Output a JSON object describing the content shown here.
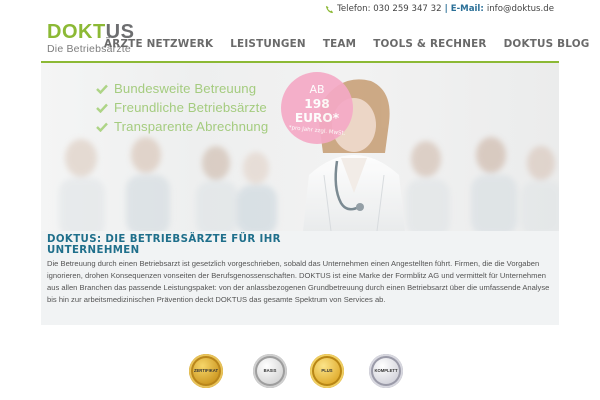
{
  "topbar": {
    "phone": "Telefon: 030 259 347 32",
    "separator": "|",
    "email_label": "E-Mail:",
    "email": "info@doktus.de"
  },
  "logo": {
    "brand_a": "DOKT",
    "brand_b": "US",
    "tagline": "Die Betriebsärzte"
  },
  "nav": {
    "items": [
      "ÄRZTE NETZWERK",
      "LEISTUNGEN",
      "TEAM",
      "TOOLS & RECHNER",
      "DOKTUS BLOG"
    ]
  },
  "hero": {
    "benefits": [
      "Bundesweite Betreuung",
      "Freundliche Betriebsärzte",
      "Transparente Abrechnung"
    ],
    "badge": {
      "ab": "AB",
      "price": "198 EURO*",
      "note": "*pro Jahr zzgl. MwSt."
    }
  },
  "intro": {
    "heading": "DOKTUS: DIE BETRIEBSÄRZTE FÜR IHR UNTERNEHMEN",
    "body": "Die Betreuung durch einen Betriebsarzt ist gesetzlich vorgeschrieben, sobald das Unternehmen einen Angestellten führt. Firmen, die die Vorgaben ignorieren, drohen Konsequenzen vonseiten der Berufsgenossenschaften. DOKTUS ist eine Marke der Formblitz AG und vermittelt für Unternehmen aus allen Branchen das passende Leistungspaket: von der anlassbezogenen Grundbetreuung durch einen Betriebsarzt über die umfassende Analyse bis hin zur arbeitsmedizinischen Prävention deckt DOKTUS das gesamte Spektrum von Services ab."
  },
  "seals": [
    {
      "label": "ZERTIFIKAT",
      "color": "#d9a520"
    },
    {
      "label": "BASIS",
      "color": "#c9c9c9"
    },
    {
      "label": "PLUS",
      "color": "#e4b43a"
    },
    {
      "label": "KOMPLETT",
      "color": "#c8c8d0"
    }
  ],
  "colors": {
    "brand_green": "#8cb935",
    "heading_blue": "#1f6f8b",
    "badge_pink": "#f5aac6"
  }
}
